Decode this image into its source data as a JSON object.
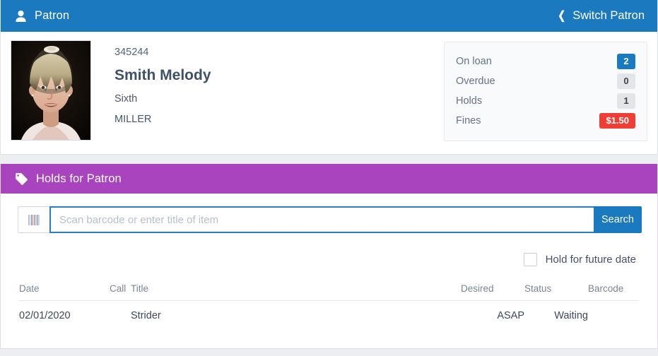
{
  "colors": {
    "header_blue": "#1b79bf",
    "header_purple": "#a844be",
    "page_background": "#eceef2",
    "badge_red": "#ef3e36",
    "badge_grey": "#e3e5e9",
    "input_focus_border": "#2a7fc4"
  },
  "patron_panel": {
    "title": "Patron",
    "person_icon": "person-icon",
    "switch_label": "Switch Patron",
    "switch_chevron_icon": "chevron-left-icon",
    "avatar_alt": "patron-photo",
    "patron_id": "345244",
    "patron_name": "Smith Melody",
    "grade": "Sixth",
    "school": "MILLER",
    "stats": [
      {
        "label": "On loan",
        "value": "2",
        "style": "blue"
      },
      {
        "label": "Overdue",
        "value": "0",
        "style": "grey"
      },
      {
        "label": "Holds",
        "value": "1",
        "style": "grey"
      },
      {
        "label": "Fines",
        "value": "$1.50",
        "style": "red"
      }
    ]
  },
  "holds_panel": {
    "title": "Holds for Patron",
    "tag_icon": "tag-icon",
    "search": {
      "barcode_icon": "barcode-icon",
      "placeholder": "Scan barcode or enter title of item",
      "value": "",
      "button_label": "Search"
    },
    "future_date": {
      "label": "Hold for future date",
      "checked": false
    },
    "table": {
      "columns": [
        "Date",
        "Call",
        "Title",
        "Desired",
        "Status",
        "Barcode"
      ],
      "rows": [
        {
          "date": "02/01/2020",
          "call": "",
          "title": "Strider",
          "desired": "ASAP",
          "status": "Waiting",
          "barcode": ""
        }
      ]
    }
  }
}
